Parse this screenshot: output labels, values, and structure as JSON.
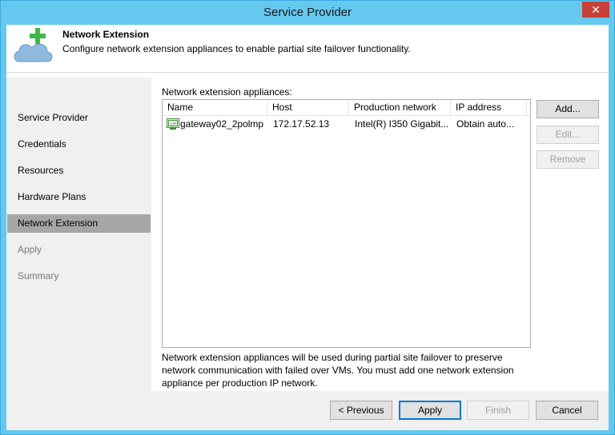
{
  "window": {
    "title": "Service Provider",
    "close_glyph": "✕"
  },
  "header": {
    "title": "Network Extension",
    "description": "Configure network extension appliances to enable partial site failover functionality.",
    "icon": "cloud-plus-icon"
  },
  "sidebar": {
    "steps": [
      {
        "label": "Service Provider"
      },
      {
        "label": "Credentials"
      },
      {
        "label": "Resources"
      },
      {
        "label": "Hardware Plans"
      },
      {
        "label": "Network Extension"
      },
      {
        "label": "Apply"
      },
      {
        "label": "Summary"
      }
    ],
    "active_index": 4
  },
  "content": {
    "list_caption": "Network extension appliances:",
    "columns": [
      "Name",
      "Host",
      "Production network",
      "IP address"
    ],
    "rows": [
      {
        "name": "gateway02_2polmp",
        "host": "172.17.52.13",
        "network": "Intel(R) I350 Gigabit...",
        "ip": "Obtain auto...",
        "icon": "vm-appliance-icon"
      }
    ],
    "buttons": {
      "add": "Add...",
      "edit": "Edit...",
      "remove": "Remove"
    },
    "note": "Network extension appliances will be used during partial site failover to preserve network communication with failed over VMs. You must add one network extension appliance per production IP network."
  },
  "footer": {
    "previous": "< Previous",
    "apply": "Apply",
    "finish": "Finish",
    "cancel": "Cancel"
  },
  "colors": {
    "titlebar": "#64c8ef",
    "active_step": "#a6a6a6",
    "cloud": "#8fb9dd",
    "plus": "#3db847",
    "default_button_border": "#0078d7"
  }
}
